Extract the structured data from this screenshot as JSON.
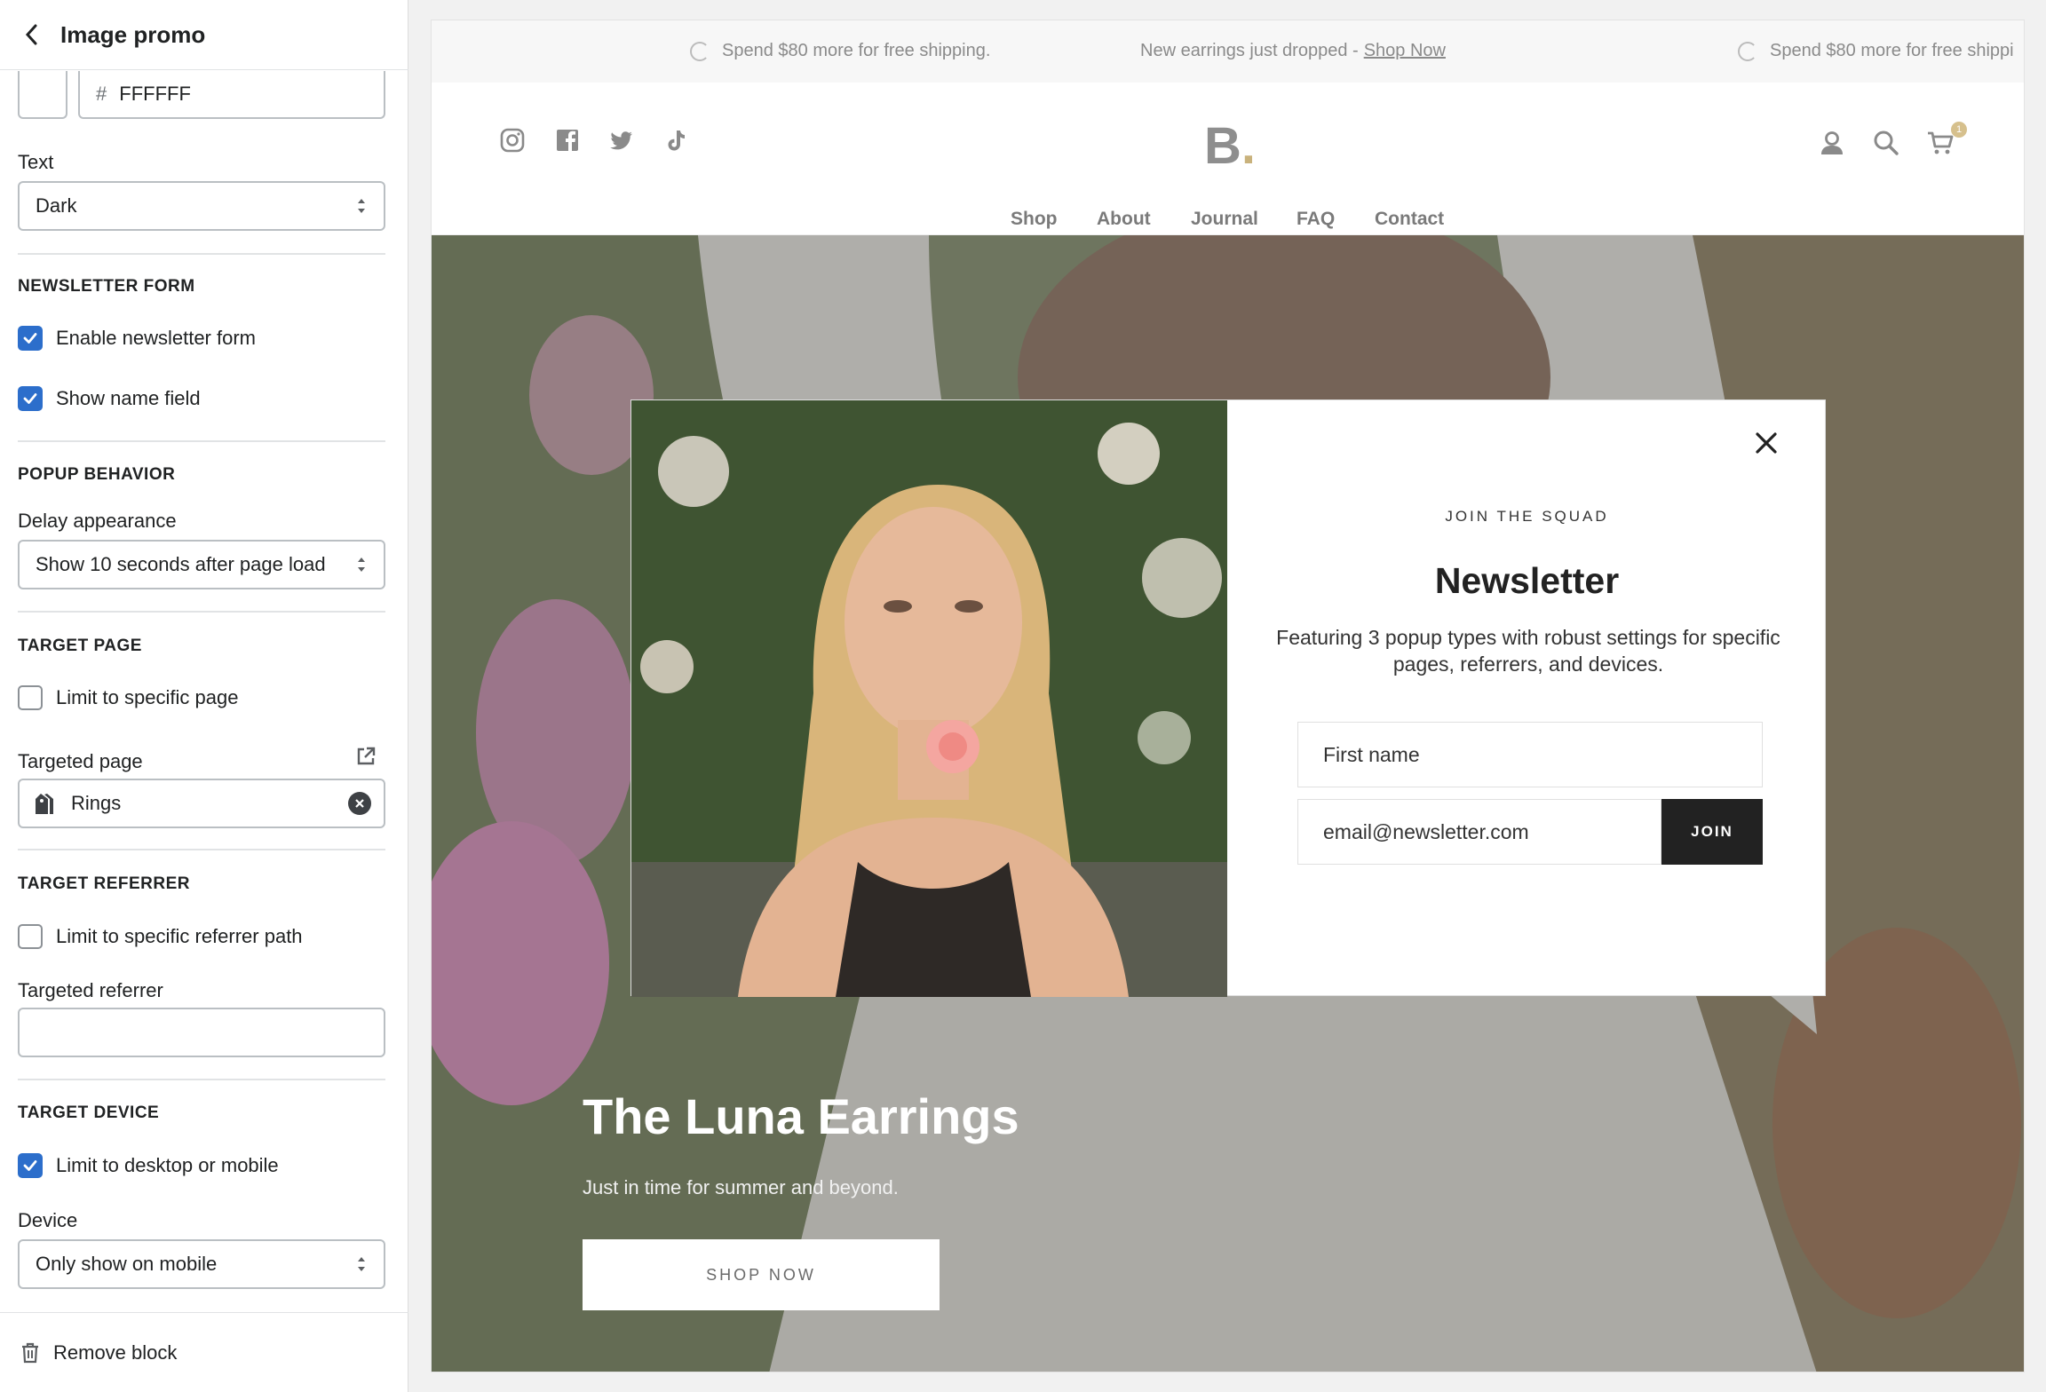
{
  "panel": {
    "title": "Image promo",
    "hex_value": "FFFFFF",
    "hash": "#",
    "text_label": "Text",
    "text_value": "Dark",
    "newsletter_section": "NEWSLETTER FORM",
    "enable_newsletter": {
      "label": "Enable newsletter form",
      "checked": true
    },
    "show_name": {
      "label": "Show name field",
      "checked": true
    },
    "popup_section": "POPUP BEHAVIOR",
    "delay_label": "Delay appearance",
    "delay_value": "Show 10 seconds after page load",
    "target_page_section": "TARGET PAGE",
    "limit_page": {
      "label": "Limit to specific page",
      "checked": false
    },
    "targeted_page_label": "Targeted page",
    "targeted_page_value": "Rings",
    "target_referrer_section": "TARGET REFERRER",
    "limit_referrer": {
      "label": "Limit to specific referrer path",
      "checked": false
    },
    "targeted_referrer_label": "Targeted referrer",
    "targeted_referrer_value": "",
    "target_device_section": "TARGET DEVICE",
    "limit_device": {
      "label": "Limit to desktop or mobile",
      "checked": true
    },
    "device_label": "Device",
    "device_value": "Only show on mobile",
    "remove_label": "Remove block"
  },
  "preview": {
    "announcement": {
      "item1": "Spend $80 more for free shipping.",
      "item2_text": "New earrings just dropped -",
      "item2_link": "Shop Now",
      "item3": "Spend $80 more for free shippi"
    },
    "logo": "B",
    "logo_dot": ".",
    "cart_count": "1",
    "nav": [
      "Shop",
      "About",
      "Journal",
      "FAQ",
      "Contact"
    ],
    "hero": {
      "title": "The Luna Earrings",
      "subtitle": "Just in time for summer and beyond.",
      "button": "SHOP NOW"
    },
    "popup": {
      "eyebrow": "JOIN THE SQUAD",
      "title": "Newsletter",
      "description": "Featuring 3 popup types with robust settings for specific pages, referrers, and devices.",
      "first_name_placeholder": "First name",
      "email_placeholder": "email@newsletter.com",
      "join_label": "JOIN"
    }
  },
  "colors": {
    "accent": "#2c6ecb",
    "logo_dot": "#c9b27c",
    "join_button": "#222222"
  },
  "icons": [
    "chevron-left-icon",
    "select-arrows-icon",
    "checkmark-icon",
    "collection-icon",
    "external-link-icon",
    "clear-icon",
    "trash-icon",
    "instagram-icon",
    "facebook-icon",
    "twitter-icon",
    "tiktok-icon",
    "account-icon",
    "search-icon",
    "cart-icon",
    "close-icon"
  ]
}
